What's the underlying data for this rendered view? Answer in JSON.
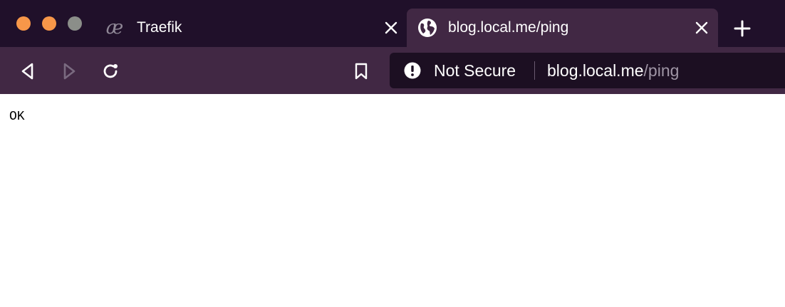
{
  "window": {
    "controls": [
      "close",
      "minimize",
      "maximize"
    ]
  },
  "tabs": [
    {
      "icon": "aether-logo-icon",
      "icon_glyph": "æ",
      "title": "Traefik",
      "active": false
    },
    {
      "icon": "globe-icon",
      "title": "blog.local.me/ping",
      "active": true
    }
  ],
  "toolbar": {
    "buttons": [
      "back-arrow-icon",
      "forward-arrow-icon",
      "reload-icon",
      "bookmark-icon"
    ],
    "security_label": "Not Secure",
    "url_host": "blog.local.me",
    "url_path": "/ping"
  },
  "page": {
    "body_text": "OK"
  },
  "colors": {
    "tab_strip": "#20102a",
    "active_tab": "#412844",
    "url_bar": "#1c0f22",
    "traffic_close": "#f79749",
    "traffic_minimize": "#f79749",
    "traffic_maximize": "#8b8e89"
  }
}
